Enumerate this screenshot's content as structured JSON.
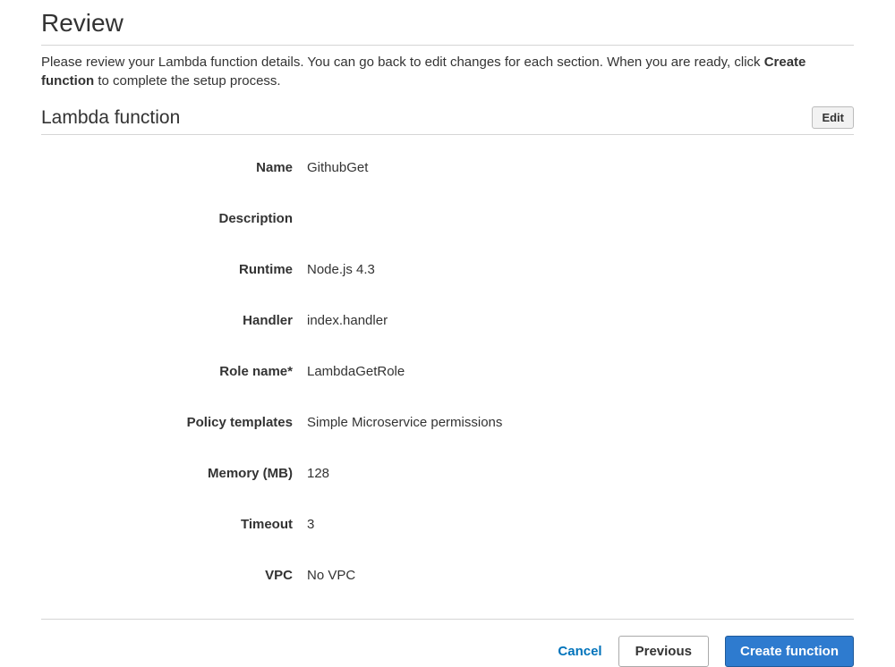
{
  "header": {
    "title": "Review",
    "instruction_prefix": "Please review your Lambda function details. You can go back to edit changes for each section. When you are ready, click ",
    "instruction_bold": "Create function",
    "instruction_suffix": " to complete the setup process."
  },
  "section": {
    "title": "Lambda function",
    "edit_label": "Edit"
  },
  "fields": [
    {
      "label": "Name",
      "value": "GithubGet"
    },
    {
      "label": "Description",
      "value": ""
    },
    {
      "label": "Runtime",
      "value": "Node.js 4.3"
    },
    {
      "label": "Handler",
      "value": "index.handler"
    },
    {
      "label": "Role name*",
      "value": "LambdaGetRole"
    },
    {
      "label": "Policy templates",
      "value": "Simple Microservice permissions"
    },
    {
      "label": "Memory (MB)",
      "value": "128"
    },
    {
      "label": "Timeout",
      "value": "3"
    },
    {
      "label": "VPC",
      "value": "No VPC"
    }
  ],
  "footer": {
    "cancel": "Cancel",
    "previous": "Previous",
    "create": "Create function"
  }
}
